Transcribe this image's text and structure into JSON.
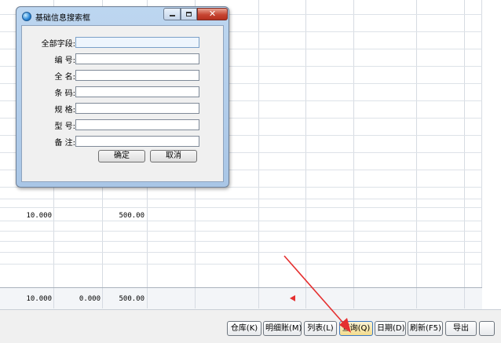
{
  "grid": {
    "row_values": {
      "col1": "10.000",
      "col3": "500.00"
    },
    "total_values": {
      "col1": "10.000",
      "col2": "0.000",
      "col3": "500.00"
    }
  },
  "toolbar": {
    "buttons": [
      {
        "label": "仓库(K)"
      },
      {
        "label": "明细账(M)"
      },
      {
        "label": "列表(L)"
      },
      {
        "label": "查询(Q)"
      },
      {
        "label": "日期(D)"
      },
      {
        "label": "刷新(F5)"
      },
      {
        "label": "导出"
      }
    ]
  },
  "dialog": {
    "title": "基础信息搜索框",
    "fields": [
      {
        "label": "全部字段:",
        "value": ""
      },
      {
        "label": "编  号:",
        "value": ""
      },
      {
        "label": "全  名:",
        "value": ""
      },
      {
        "label": "条  码:",
        "value": ""
      },
      {
        "label": "规  格:",
        "value": ""
      },
      {
        "label": "型  号:",
        "value": ""
      },
      {
        "label": "备  注:",
        "value": ""
      }
    ],
    "ok_label": "确定",
    "cancel_label": "取消"
  },
  "colors": {
    "accent": "#3a78c2",
    "arrow": "#e53030",
    "close": "#c74532"
  },
  "icons": {
    "title": "app-globe-icon",
    "minimize": "minimize-icon",
    "maximize": "maximize-icon",
    "close": "close-icon"
  }
}
